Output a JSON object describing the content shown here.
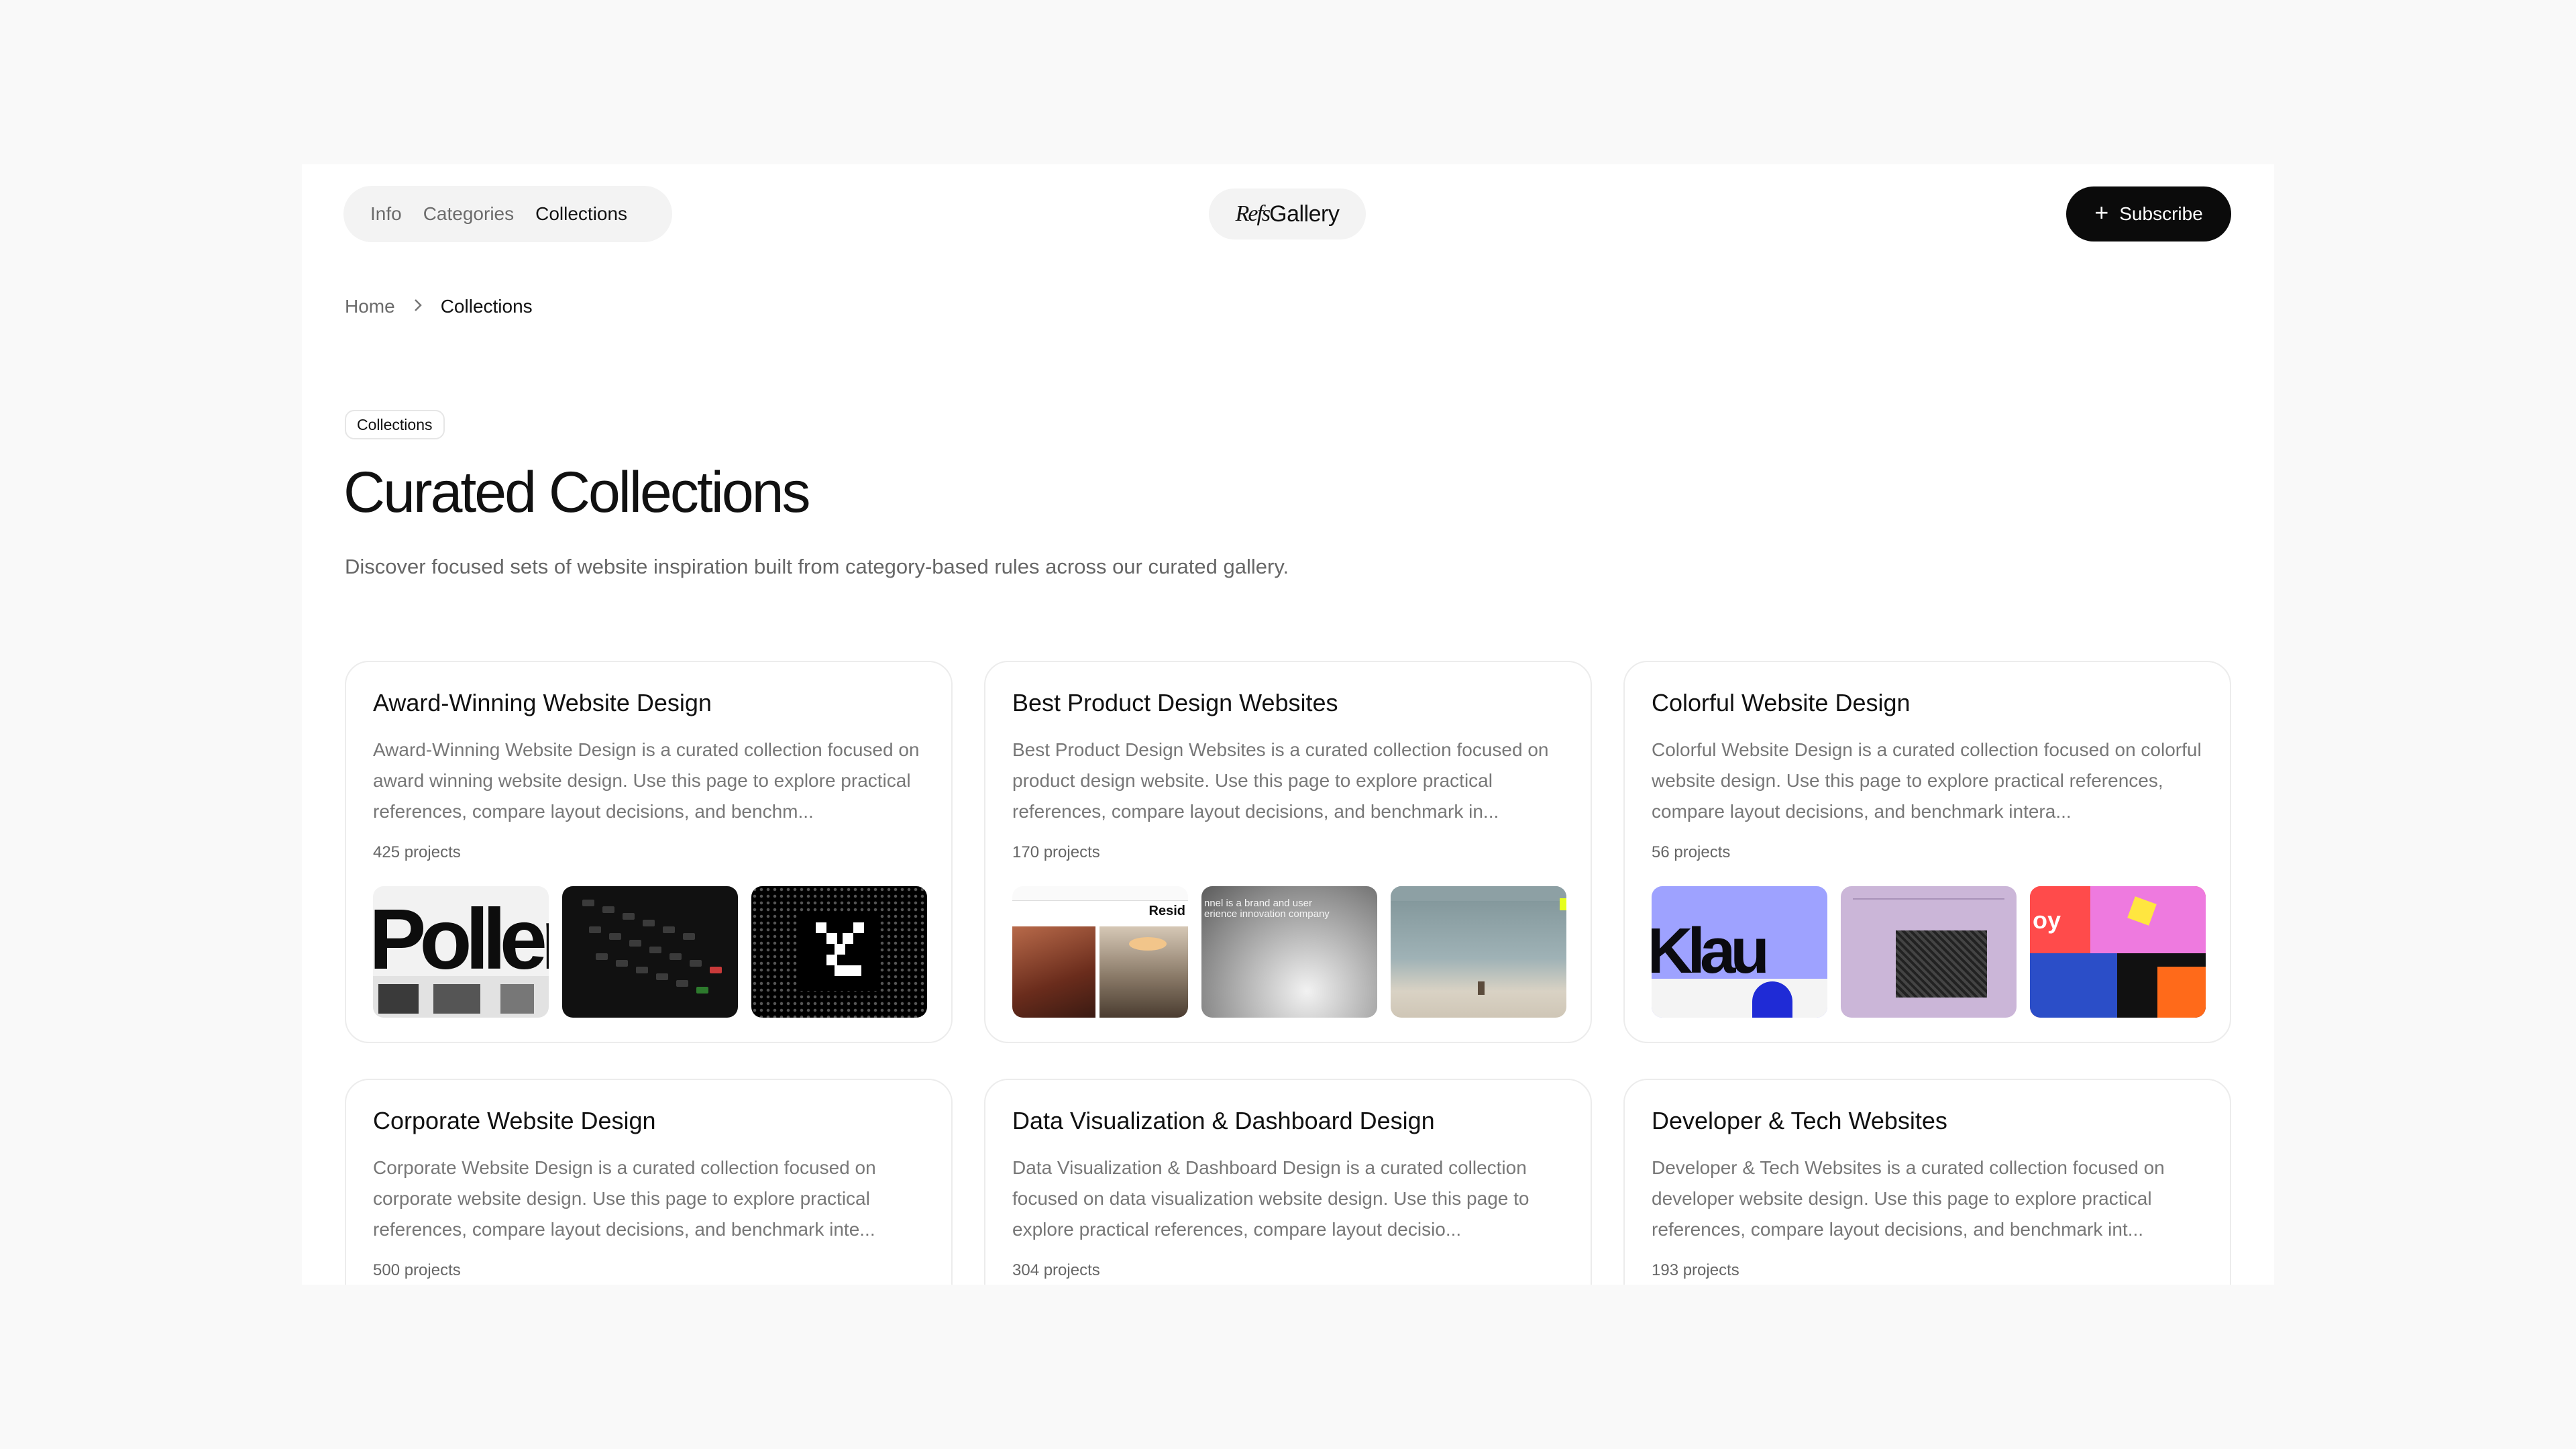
{
  "nav": {
    "items": [
      {
        "label": "Info",
        "active": false
      },
      {
        "label": "Categories",
        "active": false
      },
      {
        "label": "Collections",
        "active": true
      }
    ]
  },
  "logo": {
    "refs": "Refs",
    "gallery": "Gallery"
  },
  "subscribe": {
    "icon": "plus-icon",
    "label": "Subscribe"
  },
  "breadcrumb": {
    "home": "Home",
    "separator_icon": "chevron-right-icon",
    "current": "Collections"
  },
  "hero": {
    "badge": "Collections",
    "title": "Curated Collections",
    "description": "Discover focused sets of website inspiration built from category-based rules across our curated gallery."
  },
  "cards": [
    {
      "title": "Award-Winning Website Design",
      "description": "Award-Winning Website Design is a curated collection focused on award winning website design. Use this page to explore practical references, compare layout decisions, and benchm...",
      "count": "425 projects",
      "thumb_text": "Poller"
    },
    {
      "title": "Best Product Design Websites",
      "description": "Best Product Design Websites is a curated collection focused on product design website. Use this page to explore practical references, compare layout decisions, and benchmark in...",
      "count": "170 projects",
      "thumb_text": "Resid",
      "thumb_text_2": "nnel is a brand and user\nerience innovation company"
    },
    {
      "title": "Colorful Website Design",
      "description": "Colorful Website Design is a curated collection focused on colorful website design. Use this page to explore practical references, compare layout decisions, and benchmark intera...",
      "count": "56 projects",
      "thumb_text": "Klau",
      "thumb_text_2": "oy"
    },
    {
      "title": "Corporate Website Design",
      "description": "Corporate Website Design is a curated collection focused on corporate website design. Use this page to explore practical references, compare layout decisions, and benchmark inte...",
      "count": "500 projects"
    },
    {
      "title": "Data Visualization & Dashboard Design",
      "description": "Data Visualization & Dashboard Design is a curated collection focused on data visualization website design. Use this page to explore practical references, compare layout decisio...",
      "count": "304 projects"
    },
    {
      "title": "Developer & Tech Websites",
      "description": "Developer & Tech Websites is a curated collection focused on developer website design. Use this page to explore practical references, compare layout decisions, and benchmark int...",
      "count": "193 projects"
    }
  ]
}
